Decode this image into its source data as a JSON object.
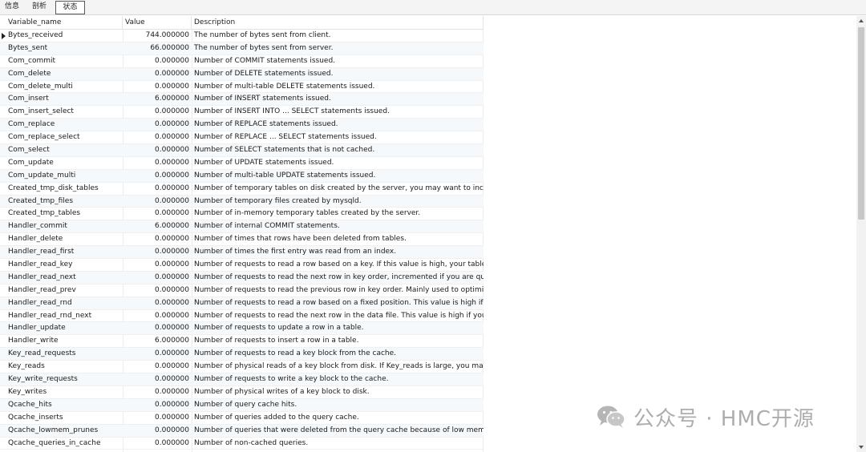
{
  "tabs": [
    {
      "label": "信息"
    },
    {
      "label": "剖析"
    },
    {
      "label": "状态"
    }
  ],
  "columns": {
    "name": "Variable_name",
    "value": "Value",
    "description": "Description"
  },
  "rows": [
    {
      "name": "Bytes_received",
      "value": "744.000000",
      "description": "The number of bytes sent from client."
    },
    {
      "name": "Bytes_sent",
      "value": "66.000000",
      "description": "The number of bytes sent from server."
    },
    {
      "name": "Com_commit",
      "value": "0.000000",
      "description": "Number of COMMIT statements issued."
    },
    {
      "name": "Com_delete",
      "value": "0.000000",
      "description": "Number of DELETE statements issued."
    },
    {
      "name": "Com_delete_multi",
      "value": "0.000000",
      "description": "Number of multi-table DELETE statements issued."
    },
    {
      "name": "Com_insert",
      "value": "6.000000",
      "description": "Number of INSERT statements issued."
    },
    {
      "name": "Com_insert_select",
      "value": "0.000000",
      "description": "Number of INSERT INTO ... SELECT statements issued."
    },
    {
      "name": "Com_replace",
      "value": "0.000000",
      "description": "Number of REPLACE statements issued."
    },
    {
      "name": "Com_replace_select",
      "value": "0.000000",
      "description": "Number of REPLACE ... SELECT statements issued."
    },
    {
      "name": "Com_select",
      "value": "0.000000",
      "description": "Number of SELECT statements that is not cached."
    },
    {
      "name": "Com_update",
      "value": "0.000000",
      "description": "Number of UPDATE statements issued."
    },
    {
      "name": "Com_update_multi",
      "value": "0.000000",
      "description": "Number of multi-table UPDATE statements issued."
    },
    {
      "name": "Created_tmp_disk_tables",
      "value": "0.000000",
      "description": "Number of temporary tables on disk created by the server, you may want to increase"
    },
    {
      "name": "Created_tmp_files",
      "value": "0.000000",
      "description": "Number of temporary files created by mysqld."
    },
    {
      "name": "Created_tmp_tables",
      "value": "0.000000",
      "description": "Number of in-memory temporary tables created by the server."
    },
    {
      "name": "Handler_commit",
      "value": "6.000000",
      "description": "Number of internal COMMIT statements."
    },
    {
      "name": "Handler_delete",
      "value": "0.000000",
      "description": "Number of times that rows have been deleted from tables."
    },
    {
      "name": "Handler_read_first",
      "value": "0.000000",
      "description": "Number of times the first entry was read from an index."
    },
    {
      "name": "Handler_read_key",
      "value": "0.000000",
      "description": "Number of requests to read a row based on a key. If this value is high, your tables m"
    },
    {
      "name": "Handler_read_next",
      "value": "0.000000",
      "description": "Number of requests to read the next row in key order, incremented if you are queryir"
    },
    {
      "name": "Handler_read_prev",
      "value": "0.000000",
      "description": "Number of requests to read the previous row in key order. Mainly used to optimize C"
    },
    {
      "name": "Handler_read_rnd",
      "value": "0.000000",
      "description": "Number of requests to read a row based on a fixed position. This value is high if you"
    },
    {
      "name": "Handler_read_rnd_next",
      "value": "0.000000",
      "description": "Number of requests to read the next row in the data file. This value is high if you are"
    },
    {
      "name": "Handler_update",
      "value": "0.000000",
      "description": "Number of requests to update a row in a table."
    },
    {
      "name": "Handler_write",
      "value": "6.000000",
      "description": "Number of requests to insert a row in a table."
    },
    {
      "name": "Key_read_requests",
      "value": "0.000000",
      "description": "Number of requests to read a key block from the cache."
    },
    {
      "name": "Key_reads",
      "value": "0.000000",
      "description": "Number of physical reads of a key block from disk. If Key_reads is large, you may wa"
    },
    {
      "name": "Key_write_requests",
      "value": "0.000000",
      "description": "Number of requests to write a key block to the cache."
    },
    {
      "name": "Key_writes",
      "value": "0.000000",
      "description": "Number of physical writes of a key block to disk."
    },
    {
      "name": "Qcache_hits",
      "value": "0.000000",
      "description": "Number of query cache hits."
    },
    {
      "name": "Qcache_inserts",
      "value": "0.000000",
      "description": "Number of queries added to the query cache."
    },
    {
      "name": "Qcache_lowmem_prunes",
      "value": "0.000000",
      "description": "Number of queries that were deleted from the query cache because of low memory."
    },
    {
      "name": "Qcache_queries_in_cache",
      "value": "0.000000",
      "description": "Number of non-cached queries."
    }
  ],
  "watermark": {
    "text": "公众号 · HMC开源",
    "icon": "wechat-icon"
  },
  "colors": {
    "active_tab_border": "#e02020",
    "alt_row": "#f5f9fc"
  }
}
